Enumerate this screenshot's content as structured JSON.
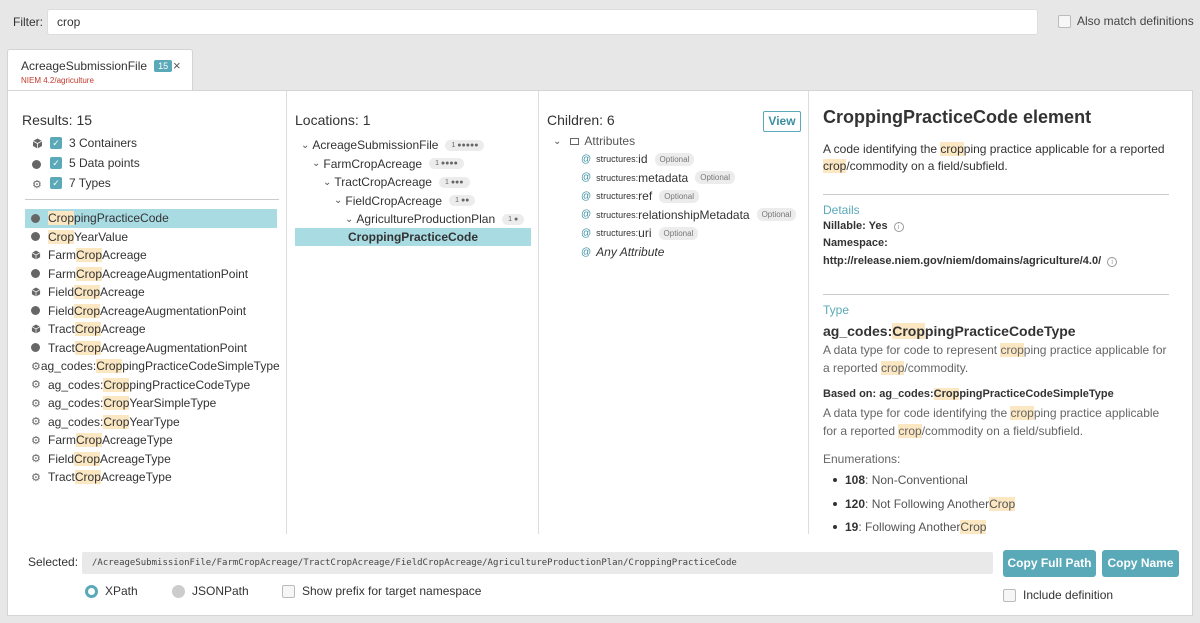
{
  "filter": {
    "label": "Filter:",
    "value": "crop",
    "also_match": "Also match definitions"
  },
  "tab": {
    "title": "AcreageSubmissionFile",
    "count": "15",
    "subtitle": "NIEM 4.2/agriculture",
    "close": "×"
  },
  "results": {
    "title": "Results: 15",
    "summary": [
      {
        "icon": "cube-icon",
        "label": "3 Containers"
      },
      {
        "icon": "dot-icon",
        "label": "5 Data points"
      },
      {
        "icon": "gear-icon",
        "label": "7 Types"
      }
    ],
    "items": [
      {
        "icon": "dot",
        "pre": "",
        "hl": "Crop",
        "post": "pingPracticeCode",
        "selected": true
      },
      {
        "icon": "dot",
        "pre": "",
        "hl": "Crop",
        "post": "YearValue"
      },
      {
        "icon": "cube",
        "pre": "Farm",
        "hl": "Crop",
        "post": "Acreage"
      },
      {
        "icon": "dot",
        "pre": "Farm",
        "hl": "Crop",
        "post": "AcreageAugmentationPoint"
      },
      {
        "icon": "cube",
        "pre": "Field",
        "hl": "Crop",
        "post": "Acreage"
      },
      {
        "icon": "dot",
        "pre": "Field",
        "hl": "Crop",
        "post": "AcreageAugmentationPoint"
      },
      {
        "icon": "cube",
        "pre": "Tract",
        "hl": "Crop",
        "post": "Acreage"
      },
      {
        "icon": "dot",
        "pre": "Tract",
        "hl": "Crop",
        "post": "AcreageAugmentationPoint"
      },
      {
        "icon": "gear",
        "pre": "ag_codes:",
        "hl": "Crop",
        "post": "pingPracticeCodeSimpleType"
      },
      {
        "icon": "gear",
        "pre": "ag_codes:",
        "hl": "Crop",
        "post": "pingPracticeCodeType"
      },
      {
        "icon": "gear",
        "pre": "ag_codes:",
        "hl": "Crop",
        "post": "YearSimpleType"
      },
      {
        "icon": "gear",
        "pre": "ag_codes:",
        "hl": "Crop",
        "post": "YearType"
      },
      {
        "icon": "gear",
        "pre": "Farm",
        "hl": "Crop",
        "post": "AcreageType"
      },
      {
        "icon": "gear",
        "pre": "Field",
        "hl": "Crop",
        "post": "AcreageType"
      },
      {
        "icon": "gear",
        "pre": "Tract",
        "hl": "Crop",
        "post": "AcreageType"
      }
    ]
  },
  "locations": {
    "title": "Locations: 1",
    "items": [
      {
        "label": "AcreageSubmissionFile",
        "pill": "1 ●●●●●"
      },
      {
        "label": "FarmCropAcreage",
        "pill": "1 ●●●●"
      },
      {
        "label": "TractCropAcreage",
        "pill": "1 ●●●"
      },
      {
        "label": "FieldCropAcreage",
        "pill": "1 ●●"
      },
      {
        "label": "AgricultureProductionPlan",
        "pill": "1 ●"
      }
    ],
    "selected": "CroppingPracticeCode"
  },
  "children": {
    "title": "Children: 6",
    "view": "View",
    "attributes_label": "Attributes",
    "items": [
      {
        "prefix": "structures:",
        "name": "id",
        "opt": "Optional"
      },
      {
        "prefix": "structures:",
        "name": "metadata",
        "opt": "Optional"
      },
      {
        "prefix": "structures:",
        "name": "ref",
        "opt": "Optional"
      },
      {
        "prefix": "structures:",
        "name": "relationshipMetadata",
        "opt": "Optional"
      },
      {
        "prefix": "structures:",
        "name": "uri",
        "opt": "Optional"
      }
    ],
    "any": "Any Attribute"
  },
  "detail": {
    "title": "CroppingPracticeCode element",
    "desc": {
      "a": "A code identifying the ",
      "hl1": "crop",
      "b": "ping practice applicable for a reported ",
      "hl2": "crop",
      "c": "/commodity on a field/subfield."
    },
    "details_label": "Details",
    "nillable_label": "Nillable:",
    "nillable_value": "Yes",
    "namespace_label": "Namespace:",
    "namespace_value": "http://release.niem.gov/niem/domains/agriculture/4.0/",
    "type_label": "Type",
    "type_name": {
      "pre": "ag_codes:",
      "hl": "Crop",
      "post": "pingPracticeCodeType"
    },
    "type_desc": {
      "a": "A data type for code to represent ",
      "hl1": "crop",
      "b": "ping practice applicable for a reported ",
      "hl2": "crop",
      "c": "/commodity."
    },
    "based_on": {
      "label": "Based on: ag_codes:",
      "hl": "Crop",
      "post": "pingPracticeCodeSimpleType"
    },
    "based_desc": {
      "a": "A data type for code identifying the ",
      "hl1": "crop",
      "b": "ping practice applicable for a reported ",
      "hl2": "crop",
      "c": "/commodity on a field/subfield."
    },
    "enum_label": "Enumerations:",
    "enums": [
      {
        "code": "108",
        "text": ": Non-Conventional",
        "hl": ""
      },
      {
        "code": "120",
        "text": ": Not Following Another ",
        "hl": "Crop"
      },
      {
        "code": "19",
        "text": ": Following Another ",
        "hl": "Crop"
      }
    ]
  },
  "footer": {
    "selected_label": "Selected:",
    "path": "/AcreageSubmissionFile/FarmCropAcreage/TractCropAcreage/FieldCropAcreage/AgricultureProductionPlan/CroppingPracticeCode",
    "copy_full_path": "Copy Full Path",
    "copy_name": "Copy Name",
    "xpath": "XPath",
    "jsonpath": "JSONPath",
    "show_prefix": "Show prefix for target namespace",
    "include_def": "Include definition"
  },
  "colors": {
    "accent": "#5aa9b8",
    "selected": "#a9dbe3",
    "highlight": "#fbe7c2"
  }
}
